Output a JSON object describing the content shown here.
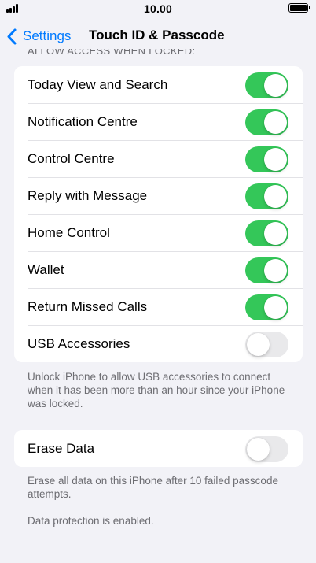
{
  "status_bar": {
    "time": "10.00"
  },
  "nav": {
    "back_label": "Settings",
    "title": "Touch ID & Passcode"
  },
  "section_header": "ALLOW ACCESS WHEN LOCKED:",
  "access_rows": [
    {
      "label": "Today View and Search",
      "on": true
    },
    {
      "label": "Notification Centre",
      "on": true
    },
    {
      "label": "Control Centre",
      "on": true
    },
    {
      "label": "Reply with Message",
      "on": true
    },
    {
      "label": "Home Control",
      "on": true
    },
    {
      "label": "Wallet",
      "on": true
    },
    {
      "label": "Return Missed Calls",
      "on": true
    },
    {
      "label": "USB Accessories",
      "on": false
    }
  ],
  "usb_footer": "Unlock iPhone to allow USB accessories to connect when it has been more than an hour since your iPhone was locked.",
  "erase": {
    "label": "Erase Data",
    "on": false
  },
  "erase_footer": "Erase all data on this iPhone after 10 failed passcode attempts.",
  "protection_note": "Data protection is enabled.",
  "colors": {
    "switch_on": "#34c759",
    "switch_off": "#e9e9eb",
    "accent": "#007aff"
  }
}
